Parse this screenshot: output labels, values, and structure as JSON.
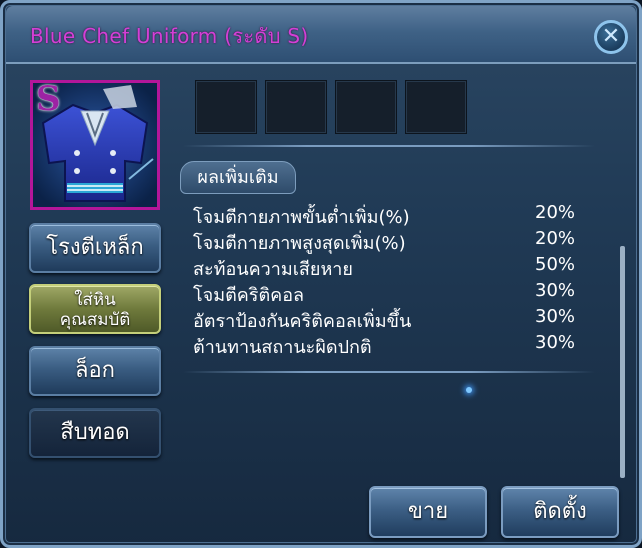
{
  "window": {
    "title": "Blue Chef Uniform (ระดับ S)",
    "close_icon": "close-icon"
  },
  "item": {
    "grade": "S",
    "icon": "blue-chef-uniform-icon"
  },
  "side_buttons": {
    "forge": "โรงตีเหล็ก",
    "socket_line1": "ใส่หิน",
    "socket_line2": "คุณสมบัติ",
    "lock": "ล็อก",
    "inherit": "สืบทอด"
  },
  "bonus": {
    "header": "ผลเพิ่มเติม",
    "stats": [
      {
        "name": "โจมตีกายภาพขั้นต่ำเพิ่ม(%)",
        "value": "20%"
      },
      {
        "name": "โจมตีกายภาพสูงสุดเพิ่ม(%)",
        "value": "20%"
      },
      {
        "name": "สะท้อนความเสียหาย",
        "value": "50%"
      },
      {
        "name": "โจมตีคริติคอล",
        "value": "30%"
      },
      {
        "name": "อัตราป้องกันคริติคอลเพิ่มขึ้น",
        "value": "30%"
      },
      {
        "name": "ต้านทานสถานะผิดปกติ",
        "value": "30%"
      }
    ]
  },
  "actions": {
    "sell": "ขาย",
    "equip": "ติดตั้ง"
  },
  "colors": {
    "title": "#d43fd6",
    "item_frame": "#b3169a",
    "accent": "#7fa3c6"
  }
}
